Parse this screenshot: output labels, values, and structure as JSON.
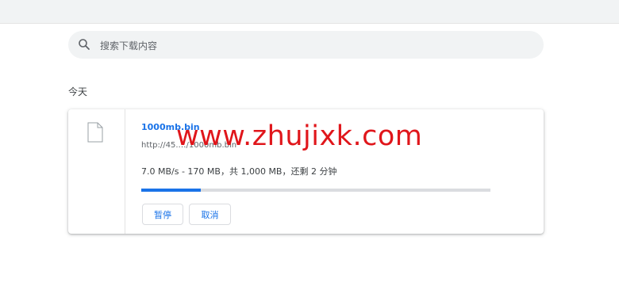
{
  "search": {
    "placeholder": "搜索下载内容"
  },
  "section": {
    "date_label": "今天"
  },
  "download": {
    "file_name": "1000mb.bin",
    "url": "http://45.…/1000mb.bin",
    "status_text": "7.0 MB/s - 170 MB，共 1,000 MB，还剩 2 分钟",
    "progress_fraction": 0.17,
    "pause_label": "暂停",
    "cancel_label": "取消"
  },
  "watermark": {
    "text": "www.zhujixk.com"
  },
  "colors": {
    "accent": "#1a73e8",
    "watermark": "#e0161b"
  }
}
